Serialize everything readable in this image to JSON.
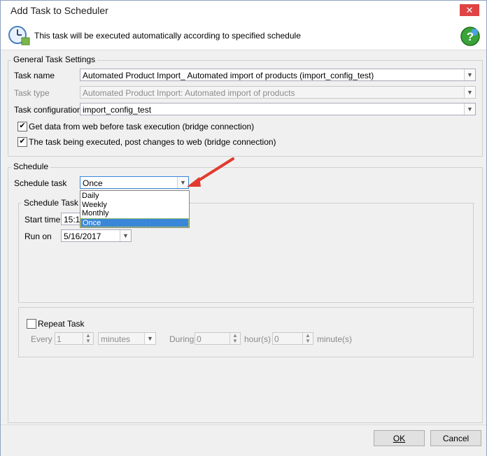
{
  "window": {
    "title": "Add Task to Scheduler",
    "close_glyph": "✕"
  },
  "info": {
    "text": "This task will be executed automatically according to specified schedule"
  },
  "general": {
    "legend": "General Task Settings",
    "task_name_label": "Task name",
    "task_name_value": "Automated Product Import_ Automated import of products (import_config_test)",
    "task_type_label": "Task type",
    "task_type_value": "Automated Product Import: Automated import of products",
    "task_config_label": "Task configuration",
    "task_config_value": "import_config_test",
    "check1_label": "Get data from web before task execution (bridge connection)",
    "check1_checked": true,
    "check2_label": "The task being executed, post changes to web (bridge connection)",
    "check2_checked": true
  },
  "schedule": {
    "legend": "Schedule",
    "schedule_task_label": "Schedule task",
    "schedule_task_value": "Once",
    "options_legend": "Schedule Task O",
    "start_time_label": "Start time",
    "start_time_value": "15:1",
    "run_on_label": "Run on",
    "run_on_value": "5/16/2017",
    "dropdown_options": [
      "Daily",
      "Weekly",
      "Monthly",
      "Once"
    ],
    "dropdown_selected": "Once",
    "repeat_label": "Repeat Task",
    "every_label": "Every",
    "every_value": "1",
    "unit_value": "minutes",
    "during_label": "During",
    "hours_value": "0",
    "hours_label": "hour(s)",
    "minutes_value": "0",
    "minutes_label": "minute(s)"
  },
  "buttons": {
    "ok": "OK",
    "cancel": "Cancel"
  },
  "colors": {
    "accent": "#3a86d8",
    "close": "#e04343",
    "annotation_arrow": "#e23a2e"
  },
  "icons": {
    "clock": "clock-icon",
    "help": "help-icon",
    "arrow": "chevron-down-icon"
  }
}
